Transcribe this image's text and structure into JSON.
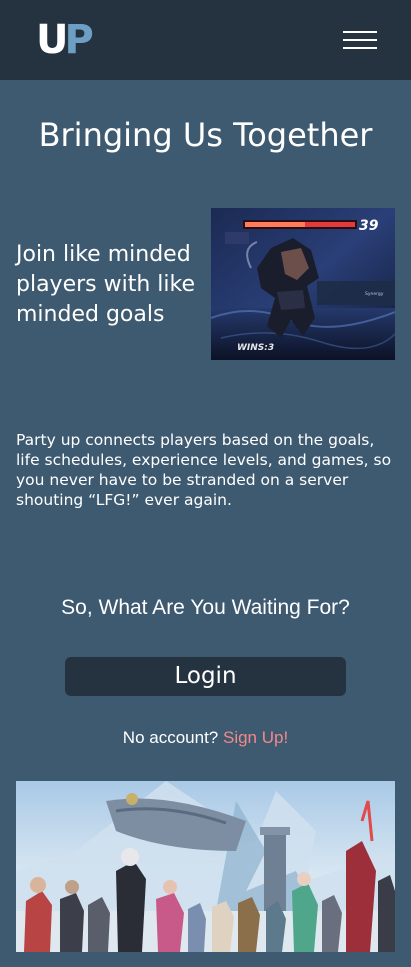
{
  "header": {
    "logo_u": "U",
    "logo_p": "P",
    "menu_icon": "hamburger-menu-icon"
  },
  "hero": {
    "title": "Bringing Us Together",
    "join_text": "Join like minded players with like minded goals",
    "screenshot1": {
      "hud_number": "39",
      "wins_label": "WINS:3",
      "panel_text": "Synergy"
    }
  },
  "description": "Party up connects players based on the goals, life schedules, experience levels, and games, so you never have to be stranded on a server shouting “LFG!” ever again.",
  "cta": {
    "heading": "So, What Are You Waiting For?",
    "login_label": "Login",
    "no_account_text": "No account?",
    "signup_label": "Sign Up!"
  },
  "colors": {
    "page_bg": "#3e5a70",
    "header_bg": "#253341",
    "button_bg": "#253341",
    "logo_accent": "#6f9ec4",
    "link": "#f08a8a"
  }
}
